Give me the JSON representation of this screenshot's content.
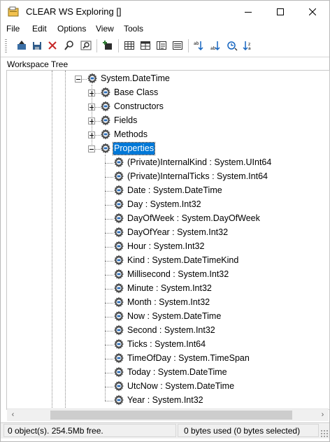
{
  "window": {
    "title": "CLEAR WS Exploring []"
  },
  "menu": [
    "File",
    "Edit",
    "Options",
    "View",
    "Tools"
  ],
  "toolbar": {
    "groups": [
      [
        "upload-icon",
        "save-icon",
        "delete-icon",
        "find-icon",
        "find-next-icon"
      ],
      [
        "new-item-icon"
      ],
      [
        "grid-view-icon",
        "table-view-icon",
        "detail-view-icon",
        "list-view-icon"
      ],
      [
        "sort-up-icon",
        "sort-down-icon",
        "refresh-icon",
        "sort-down-alt-icon"
      ]
    ]
  },
  "panel": {
    "title": "Workspace Tree"
  },
  "tree": {
    "root": {
      "label": "System.DateTime",
      "expanded": true
    },
    "groups": [
      {
        "label": "Base Class",
        "expanded": false
      },
      {
        "label": "Constructors",
        "expanded": false
      },
      {
        "label": "Fields",
        "expanded": false
      },
      {
        "label": "Methods",
        "expanded": false
      },
      {
        "label": "Properties",
        "expanded": true,
        "selected": true
      }
    ],
    "properties": [
      "(Private)InternalKind : System.UInt64",
      "(Private)InternalTicks : System.Int64",
      "Date : System.DateTime",
      "Day : System.Int32",
      "DayOfWeek : System.DayOfWeek",
      "DayOfYear : System.Int32",
      "Hour : System.Int32",
      "Kind : System.DateTimeKind",
      "Millisecond : System.Int32",
      "Minute : System.Int32",
      "Month : System.Int32",
      "Now : System.DateTime",
      "Second : System.Int32",
      "Ticks : System.Int64",
      "TimeOfDay : System.TimeSpan",
      "Today : System.DateTime",
      "UtcNow : System.DateTime",
      "Year : System.Int32"
    ]
  },
  "status": {
    "left": "0 object(s). 254.5Mb free.",
    "right": "0 bytes used (0 bytes selected)"
  },
  "colors": {
    "selection": "#0078d7"
  }
}
